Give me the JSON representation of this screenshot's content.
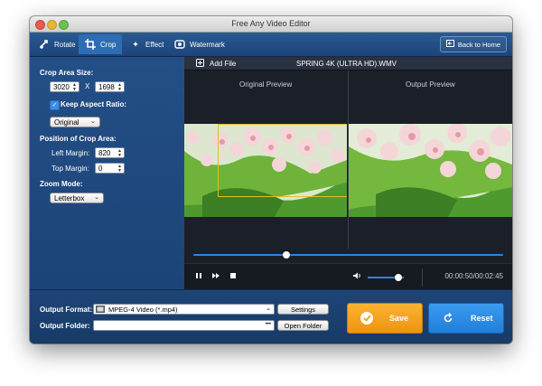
{
  "window": {
    "title": "Free Any Video Editor"
  },
  "toolbar": {
    "tabs": [
      {
        "label": "Rotate",
        "icon": "rotate-icon"
      },
      {
        "label": "Crop",
        "icon": "crop-icon"
      },
      {
        "label": "Effect",
        "icon": "effect-stars-icon"
      },
      {
        "label": "Watermark",
        "icon": "watermark-icon"
      }
    ],
    "active_tab": "Crop",
    "back_home": "Back to Home"
  },
  "crop_panel": {
    "crop_area_size_label": "Crop Area Size:",
    "width": "3020",
    "x_sep": "X",
    "height": "1698",
    "keep_aspect_label": "Keep Aspect Ratio:",
    "keep_aspect_checked": true,
    "aspect_value": "Original",
    "position_label": "Position of Crop Area:",
    "left_margin_label": "Left Margin:",
    "left_margin": "820",
    "top_margin_label": "Top Margin:",
    "top_margin": "0",
    "zoom_mode_label": "Zoom Mode:",
    "zoom_mode": "Letterbox"
  },
  "preview": {
    "add_file": "Add File",
    "file_name": "SPRING 4K (ULTRA HD).WMV",
    "original_label": "Original Preview",
    "output_label": "Output Preview"
  },
  "player": {
    "seek_fraction": 0.3,
    "volume_fraction": 0.85,
    "time": "00:00:50/00:02:45"
  },
  "output": {
    "format_label": "Output Format:",
    "format_value": "MPEG-4 Video (*.mp4)",
    "settings": "Settings",
    "folder_label": "Output Folder:",
    "folder_value": "",
    "folder_dots": "•••",
    "open_folder": "Open Folder",
    "save": "Save",
    "reset": "Reset"
  },
  "colors": {
    "accent_blue": "#2b84e0",
    "save_orange": "#f5a11a",
    "reset_blue": "#2f8ee3",
    "crop_frame": "#e0c020"
  }
}
